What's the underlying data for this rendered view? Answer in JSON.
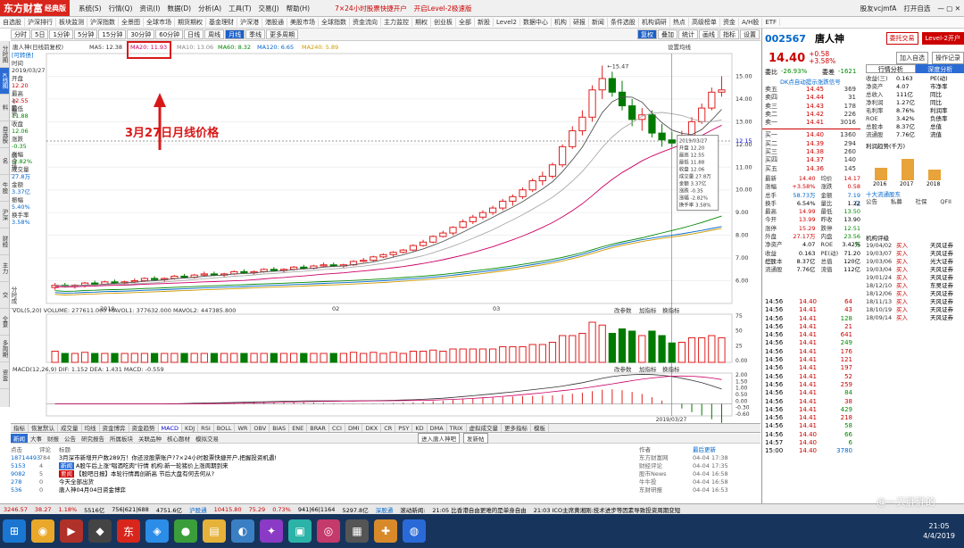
{
  "app": {
    "logo": "东方财富",
    "edition": "经典版",
    "menus": [
      "系统(S)",
      "行情(Q)",
      "资讯(I)",
      "数据(D)",
      "分析(A)",
      "工具(T)",
      "交易(J)",
      "帮助(H)"
    ],
    "promo1": "7×24小时股票快捷开户",
    "promo2": "开启Level-2极速版",
    "user": "股友vcjmfA",
    "links": [
      "打开自选"
    ]
  },
  "menu2": [
    "自选股",
    "沪深排行",
    "板块监测",
    "沪深指数",
    "全景图",
    "全球市场",
    "期货期权",
    "基金理财",
    "沪深港",
    "港股通",
    "美股市场",
    "全球指数",
    "资金流向",
    "主力监控",
    "期权",
    "创业板",
    "全部",
    "新股",
    "Level2",
    "数据中心",
    "机构",
    "研报",
    "新闻",
    "条件选股",
    "机构调研",
    "热点",
    "高级榜单",
    "资金",
    "A/H股",
    "ETF"
  ],
  "chart_toolbar": {
    "periods": [
      "分时",
      "5日",
      "1分钟",
      "5分钟",
      "15分钟",
      "30分钟",
      "60分钟",
      "日线",
      "周线",
      "月线",
      "季线",
      "更多周期"
    ],
    "active": "月线",
    "right": [
      "复权",
      "叠加",
      "统计",
      "画线",
      "指标",
      "设置"
    ],
    "setting": "设置均线"
  },
  "indicator_line": {
    "name": "唐人神(日线前复权)",
    "ma5": "MA5: 12.38",
    "ma20": "MA20: 11.93",
    "ma10": "MA10: 13.06",
    "ma60": "MA60: 8.32",
    "ma120": "MA120: 6.65",
    "ma240": "MA240: 5.89"
  },
  "left_tabs": [
    "分时图",
    "K线图",
    "个股资料",
    "自选股",
    "综合排名",
    "牛股",
    "沪深",
    "财经",
    "主力",
    "分时成交",
    "全景",
    "多周期",
    "资金",
    "板块",
    "集团"
  ],
  "infobox": {
    "tag": "[可转债]",
    "time_label": "时间",
    "date": "2019/03/27",
    "open_label": "开盘",
    "open": "12.20",
    "high_label": "最高",
    "high": "12.55",
    "low_label": "最低",
    "low": "11.88",
    "close_label": "收盘",
    "close": "12.06",
    "chg_label": "涨跌",
    "chg": "-0.35",
    "pct_label": "涨幅",
    "pct": "-2.82%",
    "vol_label": "成交量",
    "vol": "27.8万",
    "amt_label": "金额",
    "amt": "3.37亿",
    "amp_label": "振幅",
    "amp": "5.40%",
    "turn_label": "换手率",
    "turn": "3.58%"
  },
  "annotation": {
    "label": "3月27日月线价格"
  },
  "chart_data": {
    "type": "candlestick",
    "title": "唐人神(日线前复权)",
    "ylim": [
      5,
      16
    ],
    "y_ticks": [
      15.0,
      14.0,
      13.0,
      12.0,
      11.0,
      10.0,
      9.0,
      8.0,
      7.0,
      6.0
    ],
    "x_labels": [
      "2019",
      "02",
      "03"
    ],
    "current_price": "12.15",
    "high_marker": "15.47",
    "ohlc": [
      [
        5.7,
        5.9,
        5.6,
        5.8
      ],
      [
        5.8,
        5.9,
        5.7,
        5.75
      ],
      [
        5.75,
        5.85,
        5.65,
        5.8
      ],
      [
        5.8,
        5.95,
        5.7,
        5.9
      ],
      [
        5.9,
        6.0,
        5.8,
        5.85
      ],
      [
        5.85,
        6.0,
        5.8,
        5.95
      ],
      [
        5.95,
        6.05,
        5.85,
        5.9
      ],
      [
        5.9,
        6.0,
        5.8,
        5.95
      ],
      [
        5.95,
        6.1,
        5.9,
        6.0
      ],
      [
        6.0,
        6.15,
        5.95,
        6.1
      ],
      [
        6.1,
        6.2,
        6.0,
        6.05
      ],
      [
        6.05,
        6.15,
        5.95,
        6.1
      ],
      [
        6.1,
        6.25,
        6.05,
        6.2
      ],
      [
        6.2,
        6.3,
        6.1,
        6.15
      ],
      [
        6.15,
        6.3,
        6.1,
        6.25
      ],
      [
        6.25,
        6.4,
        6.2,
        6.3
      ],
      [
        6.3,
        6.4,
        6.2,
        6.25
      ],
      [
        6.25,
        6.35,
        6.15,
        6.3
      ],
      [
        6.3,
        6.45,
        6.25,
        6.4
      ],
      [
        6.4,
        6.5,
        6.3,
        6.35
      ],
      [
        6.35,
        6.45,
        6.25,
        6.4
      ],
      [
        6.4,
        6.55,
        6.35,
        6.5
      ],
      [
        6.5,
        6.6,
        6.4,
        6.45
      ],
      [
        6.45,
        6.55,
        6.35,
        6.5
      ],
      [
        6.5,
        6.65,
        6.45,
        6.6
      ],
      [
        6.6,
        6.7,
        6.5,
        6.55
      ],
      [
        6.55,
        6.7,
        6.5,
        6.65
      ],
      [
        6.65,
        6.8,
        6.6,
        6.7
      ],
      [
        6.7,
        6.8,
        6.6,
        6.65
      ],
      [
        6.65,
        6.75,
        6.55,
        6.7
      ],
      [
        6.7,
        6.9,
        6.65,
        6.85
      ],
      [
        6.85,
        7.0,
        6.8,
        6.9
      ],
      [
        6.9,
        7.1,
        6.85,
        7.05
      ],
      [
        7.05,
        7.2,
        7.0,
        7.15
      ],
      [
        7.15,
        7.3,
        7.05,
        7.25
      ],
      [
        7.25,
        7.4,
        7.2,
        7.35
      ],
      [
        7.35,
        7.6,
        7.3,
        7.55
      ],
      [
        7.55,
        7.8,
        7.5,
        7.7
      ],
      [
        7.7,
        8.0,
        7.65,
        7.95
      ],
      [
        7.95,
        8.2,
        7.9,
        8.1
      ],
      [
        8.1,
        8.4,
        8.0,
        8.35
      ],
      [
        8.35,
        8.7,
        8.3,
        8.6
      ],
      [
        8.6,
        8.9,
        8.5,
        8.8
      ],
      [
        8.8,
        9.1,
        8.7,
        9.0
      ],
      [
        9.0,
        9.3,
        8.9,
        9.2
      ],
      [
        9.2,
        9.6,
        9.1,
        9.5
      ],
      [
        9.5,
        9.8,
        9.3,
        9.7
      ],
      [
        9.7,
        10.1,
        9.6,
        10.0
      ],
      [
        10.0,
        10.5,
        9.9,
        10.4
      ],
      [
        10.4,
        10.8,
        10.2,
        10.6
      ],
      [
        10.6,
        11.2,
        10.5,
        11.1
      ],
      [
        11.1,
        12.0,
        11.0,
        11.9
      ],
      [
        11.9,
        12.8,
        11.8,
        12.6
      ],
      [
        12.6,
        13.5,
        12.4,
        13.2
      ],
      [
        13.2,
        14.6,
        13.0,
        14.4
      ],
      [
        14.4,
        15.47,
        14.0,
        14.9
      ],
      [
        14.9,
        15.2,
        14.1,
        14.3
      ],
      [
        14.3,
        14.8,
        13.5,
        13.7
      ],
      [
        13.7,
        14.0,
        12.8,
        13.1
      ],
      [
        13.1,
        13.6,
        12.6,
        13.3
      ],
      [
        13.3,
        13.5,
        12.3,
        12.5
      ],
      [
        12.5,
        12.9,
        11.9,
        12.2
      ],
      [
        12.2,
        12.55,
        11.88,
        12.06
      ],
      [
        12.06,
        12.6,
        11.9,
        12.4
      ],
      [
        12.4,
        13.2,
        12.3,
        13.0
      ],
      [
        13.0,
        13.8,
        12.9,
        13.6
      ],
      [
        13.6,
        14.5,
        13.5,
        14.3
      ],
      [
        14.3,
        15.0,
        14.1,
        14.4
      ]
    ],
    "vol_label": "VOL(5,20)  VOLUME: 277611.000  MAVOL1: 377632.000  MAVOL2: 447385.800",
    "vol_ticks": [
      "75",
      "50",
      "25",
      "0.00"
    ],
    "macd_label": "MACD(12,26,9)  DIF: 1.152  DEA: 1.431  MACD: -0.559",
    "macd_ticks": [
      "2.00",
      "1.50",
      "1.00",
      "0.50",
      "0.00",
      "-0.30",
      "-0.60"
    ],
    "sub_buttons": [
      "改参数",
      "加指标",
      "换指标"
    ],
    "date_marker": "2019/03/27"
  },
  "bottom_tabs": [
    "指标",
    "恢复默认",
    "成交量",
    "均线",
    "资金博弈",
    "资金趋势",
    "MACD",
    "KDJ",
    "RSI",
    "BOLL",
    "WR",
    "OBV",
    "BIAS",
    "ENE",
    "BRAR",
    "CCI",
    "DMI",
    "DKX",
    "CR",
    "PSY",
    "KD",
    "DMA",
    "TRIX",
    "虚拟成交量",
    "更多指标",
    "模板"
  ],
  "news_tabs": [
    "新闻",
    "大事",
    "财报",
    "公告",
    "研究报告",
    "所属板块",
    "关联品种",
    "核心题材",
    "模拟交易"
  ],
  "news_btns": [
    "进入唐人神吧",
    "发新帖"
  ],
  "news_head": [
    "点击",
    "评论",
    "标题",
    "作者",
    "最后更新"
  ],
  "news": [
    {
      "clicks": "18714493",
      "comments": "784",
      "tag": "",
      "title": "3月深市新增开户数289万！你还没股票账户?7×24小时股票快捷开户,把握投资机遇!",
      "author": "东方财富网",
      "time": "04-04 17:38"
    },
    {
      "clicks": "5153",
      "comments": "4",
      "tag": "新闻",
      "title": "A股午后上涨\"唱酒吃肉\"行情 机构:新一轮猪价上涨周期到来",
      "author": "财经评论",
      "time": "04-04 17:35"
    },
    {
      "clicks": "9082",
      "comments": "5",
      "tag": "要闻",
      "title": "【股吧日报】本轮行情再创新高 节后大盘有何去何从?",
      "author": "股市News",
      "time": "04-04 16:58"
    },
    {
      "clicks": "278",
      "comments": "0",
      "tag": "",
      "title": "今天全部出货",
      "author": "牛牛投",
      "time": "04-04 16:58"
    },
    {
      "clicks": "536",
      "comments": "0",
      "tag": "",
      "title": "唐人神04月04日资金博弈",
      "author": "东财研报",
      "time": "04-04 16:53"
    }
  ],
  "status": [
    "3246.57",
    "38.27",
    "1.18%",
    "5516亿",
    "756|621|688",
    "4751.6亿",
    "沪股通",
    "10415.80",
    "75.29",
    "0.73%",
    "941|66|1164",
    "5297.8亿",
    "深股通",
    "滚动新闻:",
    "21:05 比香港自由更难的是单身自由",
    "21:03 ICO主席黄湘刚:技术进步等因素导致投资周期变短"
  ],
  "quote": {
    "code": "002567",
    "name": "唐人神",
    "btn1": "委托交易",
    "btn2": "Level-2开户",
    "btn3": "加入自选",
    "btn4": "操作记录",
    "price": "14.40",
    "chg": "+0.58",
    "pct": "+3.58%",
    "weibi_label": "委比",
    "weibi": "-26.93%",
    "weicha_label": "委差",
    "weicha": "-1621",
    "hint": "DK点自动提示涨跌信号"
  },
  "asks": [
    {
      "l": "卖五",
      "p": "14.45",
      "v": "369"
    },
    {
      "l": "卖四",
      "p": "14.44",
      "v": "31"
    },
    {
      "l": "卖三",
      "p": "14.43",
      "v": "178"
    },
    {
      "l": "卖二",
      "p": "14.42",
      "v": "226"
    },
    {
      "l": "卖一",
      "p": "14.41",
      "v": "3016"
    }
  ],
  "bids": [
    {
      "l": "买一",
      "p": "14.40",
      "v": "1360"
    },
    {
      "l": "买二",
      "p": "14.39",
      "v": "294"
    },
    {
      "l": "买三",
      "p": "14.38",
      "v": "260"
    },
    {
      "l": "买四",
      "p": "14.37",
      "v": "140"
    },
    {
      "l": "买五",
      "p": "14.36",
      "v": "145"
    }
  ],
  "stats": [
    [
      "最新",
      "14.40",
      "均价",
      "14.17"
    ],
    [
      "涨幅",
      "+3.58%",
      "涨跌",
      "0.58"
    ],
    [
      "总手",
      "58.73万",
      "金额",
      "7.19亿"
    ],
    [
      "换手",
      "6.54%",
      "量比",
      "1.22"
    ],
    [
      "最高",
      "14.99",
      "最低",
      "13.50"
    ],
    [
      "今开",
      "13.99",
      "昨收",
      "13.90"
    ],
    [
      "涨停",
      "15.29",
      "跌停",
      "12.51"
    ],
    [
      "外盘",
      "27.17万",
      "内盘",
      "23.56万"
    ],
    [
      "净资产",
      "4.07",
      "ROE",
      "3.42%"
    ],
    [
      "收益(三)",
      "0.163",
      "PE(动)",
      "71.20"
    ],
    [
      "总股本",
      "8.37亿",
      "总值",
      "120亿"
    ],
    [
      "流通股",
      "7.76亿",
      "流值",
      "112亿"
    ]
  ],
  "ticks": [
    [
      "14:56",
      "14.40",
      "64"
    ],
    [
      "14:56",
      "14.41",
      "43"
    ],
    [
      "14:56",
      "14.41",
      "128"
    ],
    [
      "14:56",
      "14.41",
      "21"
    ],
    [
      "14:56",
      "14.41",
      "641"
    ],
    [
      "14:56",
      "14.41",
      "249"
    ],
    [
      "14:56",
      "14.41",
      "176"
    ],
    [
      "14:56",
      "14.41",
      "121"
    ],
    [
      "14:56",
      "14.41",
      "197"
    ],
    [
      "14:56",
      "14.41",
      "52"
    ],
    [
      "14:56",
      "14.41",
      "259"
    ],
    [
      "14:56",
      "14.41",
      "84"
    ],
    [
      "14:56",
      "14.41",
      "38"
    ],
    [
      "14:56",
      "14.41",
      "429"
    ],
    [
      "14:56",
      "14.41",
      "218"
    ],
    [
      "14:56",
      "14.41",
      "58"
    ],
    [
      "14:56",
      "14.40",
      "66"
    ],
    [
      "14:57",
      "14.40",
      "6"
    ],
    [
      "15:00",
      "14.40",
      "3780"
    ]
  ],
  "fin": {
    "tabs": [
      "行情分析",
      "深度分析"
    ],
    "rows": [
      [
        "收益(三)",
        "0.163",
        "PE(动)"
      ],
      [
        "净资产",
        "4.07",
        "市净率"
      ],
      [
        "总收入",
        "111亿",
        "同比"
      ],
      [
        "净利润",
        "1.27亿",
        "同比"
      ],
      [
        "毛利率",
        "8.76%",
        "利润率"
      ],
      [
        "ROE",
        "3.42%",
        "负债率"
      ],
      [
        "总股本",
        "8.37亿",
        "总值"
      ],
      [
        "流通股",
        "7.76亿",
        "流值"
      ]
    ],
    "chart_title": "利润趋势(千万)",
    "years": [
      "2016",
      "2017",
      "2018"
    ],
    "holders_title": "十大流通股东",
    "holders_cols": [
      "公告",
      "私募",
      "社保",
      "QFII"
    ],
    "ratings_title": "机构评级",
    "ratings": [
      [
        "19/04/02",
        "买入",
        "天风证券"
      ],
      [
        "19/03/07",
        "买入",
        "天风证券"
      ],
      [
        "19/03/06",
        "买入",
        "光大证券"
      ],
      [
        "19/03/04",
        "买入",
        "天风证券"
      ],
      [
        "19/01/24",
        "买入",
        "天风证券"
      ],
      [
        "18/12/10",
        "买入",
        "东吴证券"
      ],
      [
        "18/12/06",
        "买入",
        "天风证券"
      ],
      [
        "18/11/13",
        "买入",
        "天风证券"
      ],
      [
        "18/10/19",
        "买入",
        "天风证券"
      ],
      [
        "18/09/14",
        "买入",
        "天风证券"
      ]
    ]
  },
  "taskbar": {
    "time": "21:05",
    "date": "4/4/2019"
  },
  "watermark": "@一只胖胖的"
}
